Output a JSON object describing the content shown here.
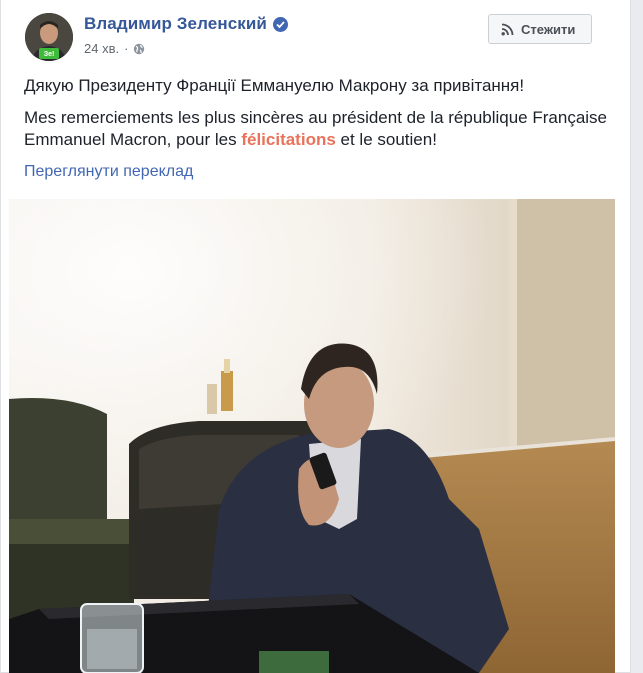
{
  "post": {
    "author": "Владимир Зеленский",
    "time": "24 хв.",
    "follow_label": "Стежити",
    "text_ua": "Дякую Президенту Франції Еммануелю Макрону за привітання!",
    "text_fr_before": "Mes remerciements les plus sincères au président de la république Française Emmanuel Macron, pour les ",
    "text_fr_highlight": "félicitations",
    "text_fr_after": " et le soutien!",
    "translate_link": "Переглянути переклад"
  },
  "avatar": {
    "badge_text": "Зе!"
  },
  "icons": {
    "verified": "verified-badge-icon",
    "privacy": "globe-icon",
    "follow": "rss-icon"
  },
  "colors": {
    "name": "#365899",
    "link": "#4267b2",
    "highlight": "#e9735b",
    "text": "#1d2129"
  }
}
